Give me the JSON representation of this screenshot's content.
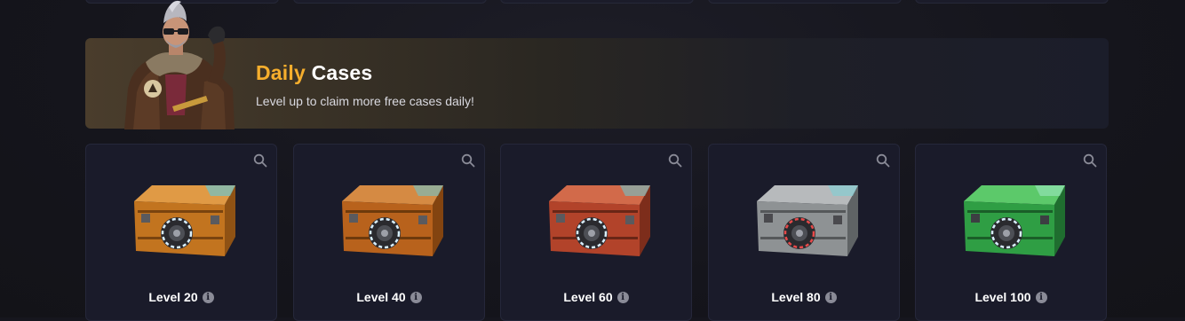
{
  "banner": {
    "title_accent": "Daily",
    "title_rest": "Cases",
    "subtitle": "Level up to claim more free cases daily!"
  },
  "colors": {
    "accent": "#f6ae2d",
    "card_bg": "#1a1b2a",
    "page_bg": "#16161e"
  },
  "cases": [
    {
      "label": "Level 20",
      "color": "#c2741f",
      "icon": "case-image"
    },
    {
      "label": "Level 40",
      "color": "#b8621c",
      "icon": "case-image"
    },
    {
      "label": "Level 60",
      "color": "#b2432a",
      "icon": "case-image"
    },
    {
      "label": "Level 80",
      "color": "#8e9294",
      "icon": "case-image"
    },
    {
      "label": "Level 100",
      "color": "#2f9e44",
      "icon": "case-image"
    }
  ]
}
